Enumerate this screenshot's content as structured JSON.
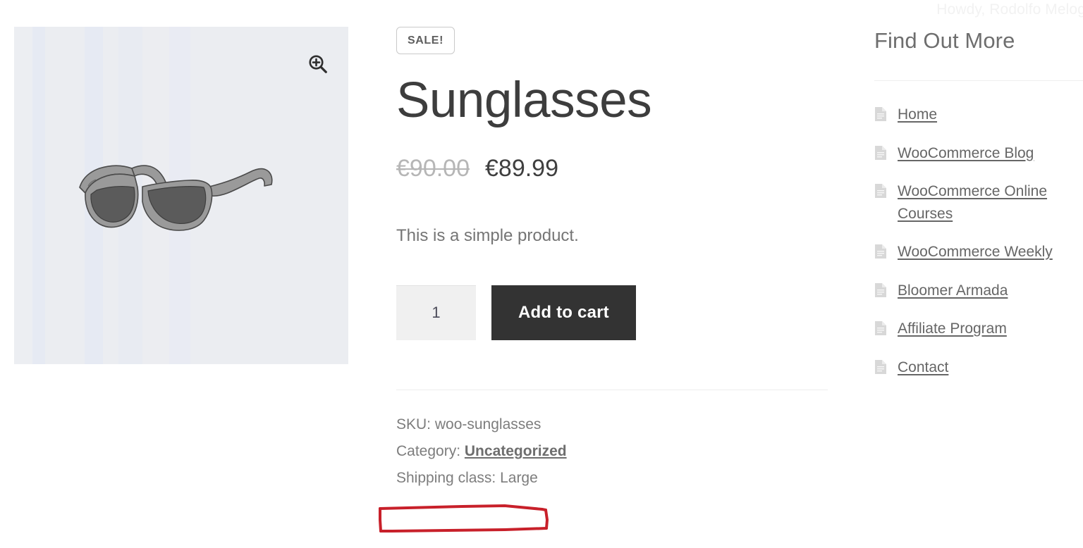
{
  "admin_bar": {
    "greeting": "Howdy, Rodolfo Melog"
  },
  "gallery": {
    "zoom_icon": "magnifier-plus-icon",
    "image_alt": "Sunglasses product photo"
  },
  "product": {
    "sale_badge": "SALE!",
    "title": "Sunglasses",
    "price_old": "€90.00",
    "price_new": "€89.99",
    "short_description": "This is a simple product.",
    "quantity_value": "1",
    "quantity_placeholder": "1",
    "add_to_cart_label": "Add to cart",
    "meta": {
      "sku_label": "SKU:",
      "sku_value": "woo-sunglasses",
      "category_label": "Category:",
      "category_value": "Uncategorized",
      "shipping_class_label": "Shipping class:",
      "shipping_class_value": "Large",
      "sku_line": "SKU: woo-sunglasses",
      "shipping_class_line": "Shipping class: Large"
    }
  },
  "annotation": {
    "color": "#c8202a",
    "target": "Shipping class: Large"
  },
  "sidebar": {
    "title": "Find Out More",
    "items": [
      {
        "label": "Home",
        "icon": "document-icon"
      },
      {
        "label": "WooCommerce Blog",
        "icon": "document-icon"
      },
      {
        "label": "WooCommerce Online Courses",
        "icon": "document-icon"
      },
      {
        "label": "WooCommerce Weekly",
        "icon": "document-icon"
      },
      {
        "label": "Bloomer Armada",
        "icon": "document-icon"
      },
      {
        "label": "Affiliate Program",
        "icon": "document-icon"
      },
      {
        "label": "Contact",
        "icon": "document-icon"
      }
    ]
  },
  "colors": {
    "page_bg": "#ffffff",
    "gallery_bg": "#eaecf0",
    "button_dark": "#333333",
    "text_muted": "#7d7d7d",
    "annotation_red": "#c8202a"
  }
}
